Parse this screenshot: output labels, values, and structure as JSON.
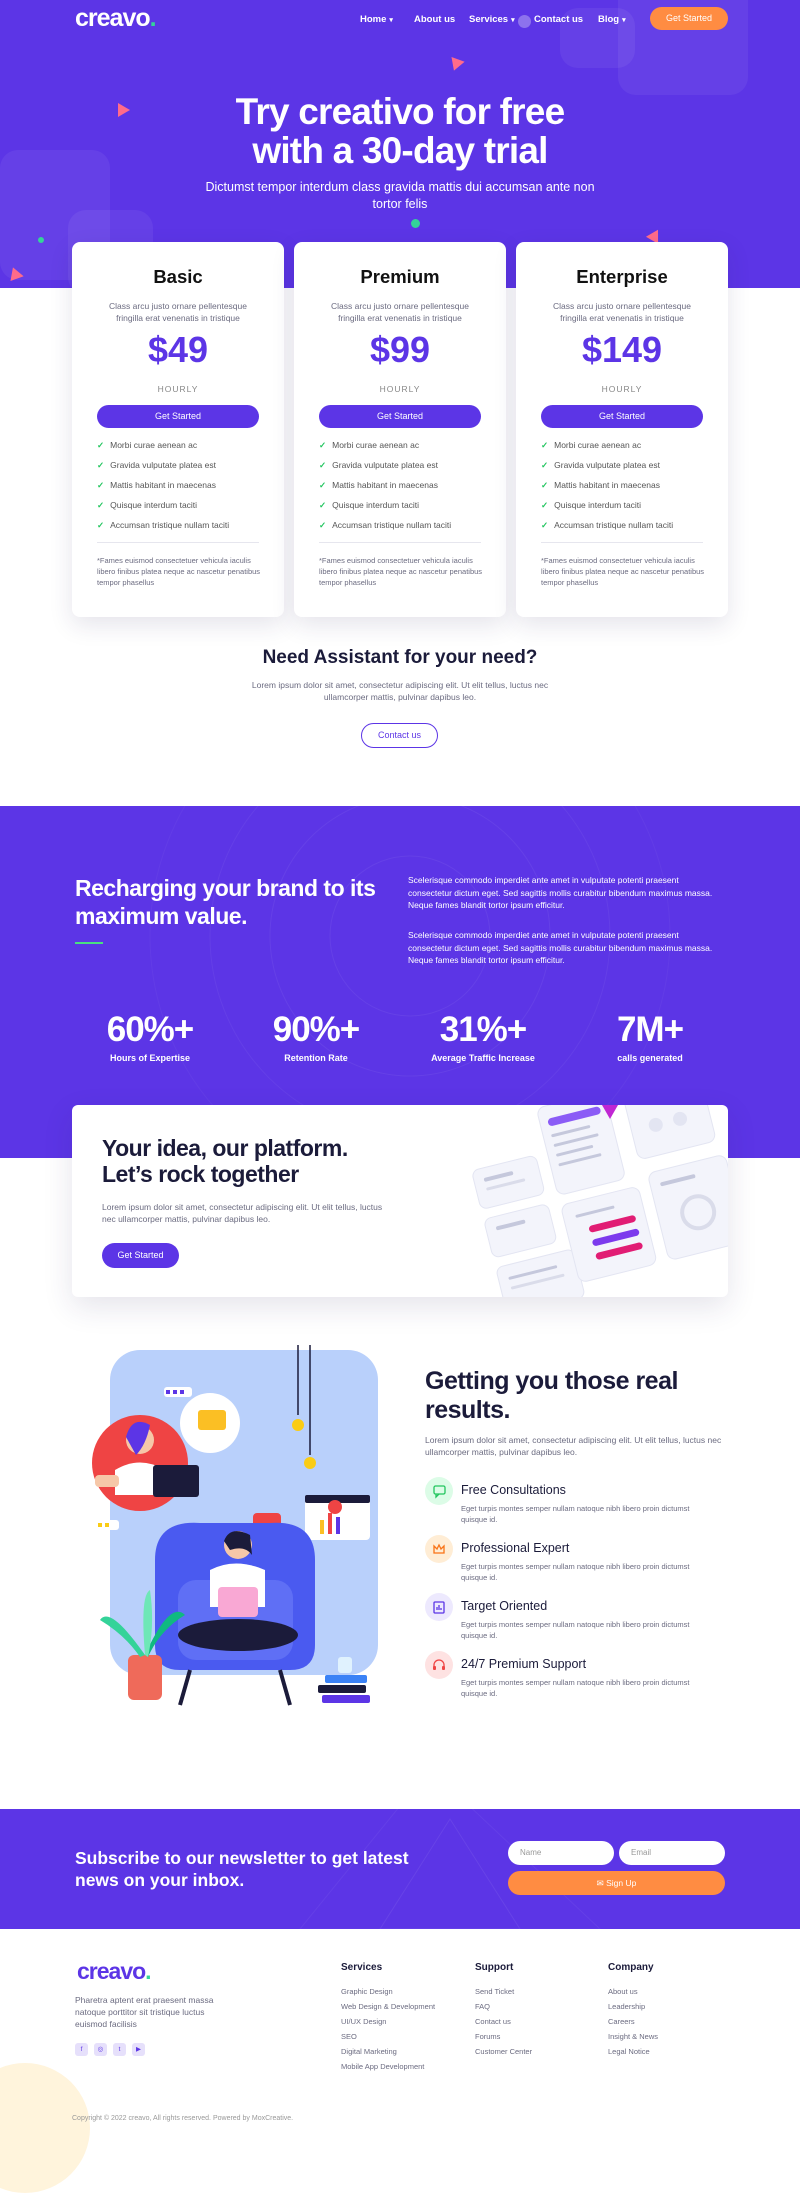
{
  "nav": {
    "logo": "creavo",
    "links": [
      "Home",
      "About us",
      "Services",
      "Contact us",
      "Blog"
    ],
    "cta": "Get Started"
  },
  "hero": {
    "title_line1": "Try creativo for free",
    "title_line2": "with a 30-day trial",
    "subtitle": "Dictumst tempor interdum class gravida mattis dui accumsan ante non tortor felis"
  },
  "plans": [
    {
      "name": "Basic",
      "desc": "Class arcu justo ornare pellentesque fringilla erat venenatis in tristique",
      "price": "$49",
      "period": "HOURLY",
      "button": "Get Started",
      "features": [
        "Morbi curae aenean ac",
        "Gravida vulputate platea est",
        "Mattis habitant in maecenas",
        "Quisque interdum taciti",
        "Accumsan tristique nullam taciti"
      ],
      "note": "*Fames euismod consectetuer vehicula iaculis libero finibus platea neque ac nascetur penatibus tempor phasellus"
    },
    {
      "name": "Premium",
      "desc": "Class arcu justo ornare pellentesque fringilla erat venenatis in tristique",
      "price": "$99",
      "period": "HOURLY",
      "button": "Get Started",
      "features": [
        "Morbi curae aenean ac",
        "Gravida vulputate platea est",
        "Mattis habitant in maecenas",
        "Quisque interdum taciti",
        "Accumsan tristique nullam taciti"
      ],
      "note": "*Fames euismod consectetuer vehicula iaculis libero finibus platea neque ac nascetur penatibus tempor phasellus"
    },
    {
      "name": "Enterprise",
      "desc": "Class arcu justo ornare pellentesque fringilla erat venenatis in tristique",
      "price": "$149",
      "period": "HOURLY",
      "button": "Get Started",
      "features": [
        "Morbi curae aenean ac",
        "Gravida vulputate platea est",
        "Mattis habitant in maecenas",
        "Quisque interdum taciti",
        "Accumsan tristique nullam taciti"
      ],
      "note": "*Fames euismod consectetuer vehicula iaculis libero finibus platea neque ac nascetur penatibus tempor phasellus"
    }
  ],
  "assist": {
    "title": "Need Assistant for your need?",
    "text": "Lorem ipsum dolor sit amet, consectetur adipiscing elit. Ut elit tellus, luctus nec ullamcorper mattis, pulvinar dapibus leo.",
    "button": "Contact us"
  },
  "brand": {
    "title": "Recharging your brand to its maximum value.",
    "p1": "Scelerisque commodo imperdiet ante amet in vulputate potenti praesent consectetur dictum eget. Sed sagittis mollis curabitur bibendum maximus massa. Neque fames blandit tortor ipsum efficitur.",
    "p2": "Scelerisque commodo imperdiet ante amet in vulputate potenti praesent consectetur dictum eget. Sed sagittis mollis curabitur bibendum maximus massa. Neque fames blandit tortor ipsum efficitur."
  },
  "stats": [
    {
      "value": "60%+",
      "label": "Hours of Expertise"
    },
    {
      "value": "90%+",
      "label": "Retention Rate"
    },
    {
      "value": "31%+",
      "label": "Average Traffic Increase"
    },
    {
      "value": "7M+",
      "label": "calls generated"
    }
  ],
  "idea": {
    "title_line1": "Your idea, our platform.",
    "title_line2": "Let’s rock together",
    "text": "Lorem ipsum dolor sit amet, consectetur adipiscing elit. Ut elit tellus, luctus nec ullamcorper mattis, pulvinar dapibus leo.",
    "button": "Get Started",
    "mock_labels": [
      "Assign New Tasks",
      "Assign New Tasks",
      "Today's Task",
      "New Board",
      "Progress"
    ]
  },
  "results": {
    "title": "Getting you those real results.",
    "text": "Lorem ipsum dolor sit amet, consectetur adipiscing elit. Ut elit tellus, luctus nec ullamcorper mattis, pulvinar dapibus leo.",
    "items": [
      {
        "title": "Free Consultations",
        "text": "Eget turpis montes semper nullam natoque nibh libero proin dictumst quisque id.",
        "icon": "chat-icon",
        "color": "#dcfce7",
        "fg": "#22c55e"
      },
      {
        "title": "Professional Expert",
        "text": "Eget turpis montes semper nullam natoque nibh libero proin dictumst quisque id.",
        "icon": "crown-icon",
        "color": "#ffedd5",
        "fg": "#f97316"
      },
      {
        "title": "Target Oriented",
        "text": "Eget turpis montes semper nullam natoque nibh libero proin dictumst quisque id.",
        "icon": "chart-icon",
        "color": "#ede9fe",
        "fg": "#5c35e6"
      },
      {
        "title": "24/7 Premium Support",
        "text": "Eget turpis montes semper nullam natoque nibh libero proin dictumst quisque id.",
        "icon": "headset-icon",
        "color": "#fee2e2",
        "fg": "#ef4444"
      }
    ]
  },
  "newsletter": {
    "title": "Subscribe to our newsletter to get latest news on your inbox.",
    "name_placeholder": "Name",
    "email_placeholder": "Email",
    "button": "Sign Up"
  },
  "footer": {
    "logo": "creavo",
    "desc": "Pharetra aptent erat praesent massa natoque porttitor sit tristique luctus euismod facilisis",
    "social": [
      "facebook-icon",
      "instagram-icon",
      "twitter-icon",
      "youtube-icon"
    ],
    "cols": [
      {
        "title": "Services",
        "links": [
          "Graphic Design",
          "Web Design & Development",
          "UI/UX Design",
          "SEO",
          "Digital Marketing",
          "Mobile App Development"
        ]
      },
      {
        "title": "Support",
        "links": [
          "Send Ticket",
          "FAQ",
          "Contact us",
          "Forums",
          "Customer Center"
        ]
      },
      {
        "title": "Company",
        "links": [
          "About us",
          "Leadership",
          "Careers",
          "Insight & News",
          "Legal Notice"
        ]
      }
    ],
    "copyright": "Copyright © 2022 creavo, All rights reserved. Powered by MoxCreative."
  },
  "colors": {
    "primary": "#5c35e6",
    "accent": "#ff8c42",
    "check": "#22c55e"
  }
}
